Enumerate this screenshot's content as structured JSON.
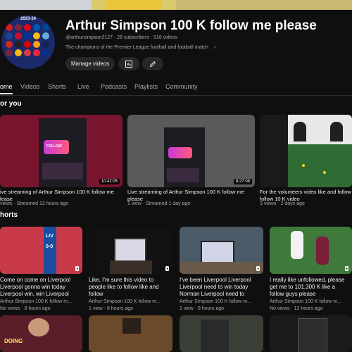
{
  "channel": {
    "season_label": "2023-24",
    "name": "Arthur Simpson 100 K follow me please",
    "handle": "@arthursimpson2127",
    "subscribers": "28 subscribers",
    "videos_count": "518 videos",
    "description": "The champions of the Premier League football and football match",
    "manage_videos_label": "Manage videos",
    "icons": [
      "analytics-icon",
      "pencil-icon"
    ]
  },
  "tabs": [
    {
      "label": "Home",
      "shown": "ome",
      "active": true
    },
    {
      "label": "Videos",
      "active": false
    },
    {
      "label": "Shorts",
      "active": false
    },
    {
      "label": "Live",
      "active": false
    },
    {
      "label": "Podcasts",
      "active": false
    },
    {
      "label": "Playlists",
      "active": false
    },
    {
      "label": "Community",
      "active": false
    }
  ],
  "for_you": {
    "title": "or you",
    "videos": [
      {
        "title_line1": "ive streaming of Arthur Simpson 100 K follow me",
        "title_line2": "lease",
        "meta": "views · Streamed 12 hours ago",
        "duration": "10:42:05"
      },
      {
        "title_line1": "Live streaming of Arthur Simpson 100 K follow me",
        "title_line2": "please",
        "meta": "1 view · Streamed 1 day ago",
        "duration": "8:27:08"
      },
      {
        "title_line1": "For the volunteers video like and follow",
        "title_line2": "follow 10 K video",
        "meta": "3 views · 2 days ago",
        "duration": ""
      }
    ]
  },
  "shorts": {
    "title": "horts",
    "items": [
      {
        "line1": "Come on come on Liverpool",
        "line2": "Liverpool gonna win today",
        "line3": "Liverpool win, win Liverpool",
        "channel": "Arthur Simpson 100 K follow m...",
        "meta": "No views · 8 hours ago"
      },
      {
        "line1": "Like, I'm sure this video to",
        "line2": "people like to follow like and",
        "line3": "follow",
        "channel": "Arthur Simpson 100 K follow m...",
        "meta": "1 view · 8 hours ago"
      },
      {
        "line1": "I've been Liverpool Liverpool",
        "line2": "Liverpool need to win today",
        "line3": "Norman Liverpool need to",
        "channel": "Arthur Simpson 100 K follow m...",
        "meta": "1 view · 8 hours ago"
      },
      {
        "line1": "I really like unfollowed, please",
        "line2": "get me to 101,300 K like a",
        "line3": "follow guys please",
        "channel": "Arthur Simpson 100 K follow m...",
        "meta": "No views · 12 hours ago"
      }
    ],
    "second_row_caption": "DOING"
  },
  "colors": {
    "background": "#0f0f0f",
    "text_secondary": "#aaaaaa",
    "button_bg": "#272727",
    "follow_pink": "#e0458f"
  }
}
